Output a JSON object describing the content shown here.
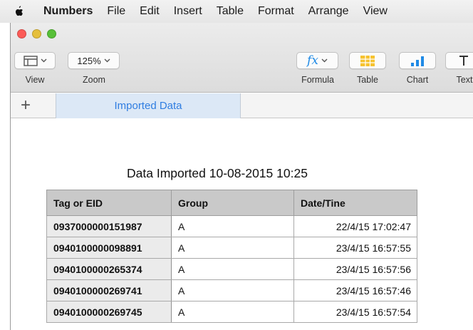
{
  "menubar": {
    "app": "Numbers",
    "items": [
      "File",
      "Edit",
      "Insert",
      "Table",
      "Format",
      "Arrange",
      "View"
    ]
  },
  "toolbar": {
    "view_label": "View",
    "zoom_value": "125%",
    "zoom_label": "Zoom",
    "formula_symbol": "fx",
    "formula_label": "Formula",
    "table_label": "Table",
    "chart_label": "Chart",
    "text_label": "Text"
  },
  "tabs": {
    "add_symbol": "+",
    "active_sheet": "Imported Data"
  },
  "table": {
    "title": "Data Imported 10-08-2015 10:25",
    "columns": [
      "Tag or EID",
      "Group",
      "Date/Tine"
    ],
    "rows": [
      [
        "0937000000151987",
        "A",
        "22/4/15 17:02:47"
      ],
      [
        "0940100000098891",
        "A",
        "23/4/15 16:57:55"
      ],
      [
        "0940100000265374",
        "A",
        "23/4/15 16:57:56"
      ],
      [
        "0940100000269741",
        "A",
        "23/4/15 16:57:46"
      ],
      [
        "0940100000269745",
        "A",
        "23/4/15 16:57:54"
      ]
    ]
  },
  "colors": {
    "accent": "#2f7de1",
    "tab_background": "#dce8f6",
    "header_fill": "#c9c9c9",
    "close": "#fc5b57",
    "minimize": "#e5bf3c",
    "zoom": "#57c038"
  }
}
